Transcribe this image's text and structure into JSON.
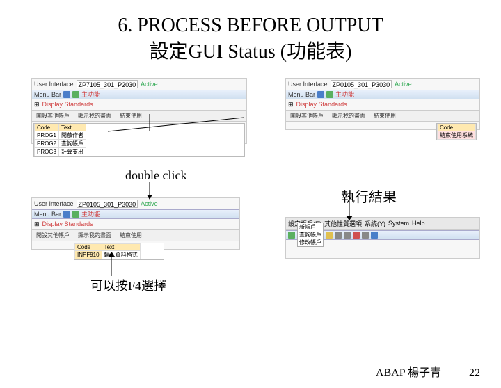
{
  "title_line1": "6. PROCESS BEFORE OUTPUT",
  "title_line2": "設定GUI Status (功能表)",
  "panel1": {
    "ui_label": "User Interface",
    "ui_value": "ZP7105_301_P2030",
    "status": "Active",
    "menu_label": "Menu Bar",
    "display_std": "Display Standards",
    "zhuhao": "主功能",
    "tabs": {
      "t1": "開設其他帳戶",
      "t2": "顯示我的畫面",
      "t3": "結束使用"
    },
    "code_hd1": "Code",
    "code_hd2": "Text",
    "r1a": "PROG1",
    "r1b": "開啟作者",
    "r2a": "PROG2",
    "r2b": "查詢帳戶",
    "r3a": "PROG3",
    "r3b": "計算支出"
  },
  "panel2": {
    "ui_label": "User Interface",
    "ui_value": "ZP0105_301_P3030",
    "status": "Active",
    "menu_label": "Menu Bar",
    "display_std": "Display Standards",
    "zhuhao": "主功能",
    "tabs": {
      "t1": "開設其他帳戶",
      "t2": "顯示我的畫面",
      "t3": "結束使用"
    },
    "code_hd": "Code",
    "r1": "結束使用系統"
  },
  "panel3": {
    "ui_label": "User Interface",
    "ui_value": "ZP0105_301_P3030",
    "status": "Active",
    "menu_label": "Menu Bar",
    "display_std": "Display Standards",
    "zhuhao": "主功能",
    "tabs": {
      "t1": "開設其他帳戶",
      "t2": "顯示我的畫面",
      "t3": "結束使用"
    },
    "code_hd1": "Code",
    "code_hd2": "Text",
    "r1a": "INPF910",
    "r1b": "輸入資料格式"
  },
  "panel4": {
    "menu": {
      "m1": "設定帳戶(E)",
      "m2": "其他性質選項",
      "m3": "系統(Y)",
      "m4": "System",
      "m5": "Help"
    },
    "item1": "新帳戶",
    "item2": "查詢帳戶",
    "item3": "修改帳戶"
  },
  "annotations": {
    "double_click": "double click",
    "result": "執行結果",
    "f4": "可以按F4選擇"
  },
  "footer": {
    "course": "ABAP 楊子青",
    "page": "22"
  }
}
